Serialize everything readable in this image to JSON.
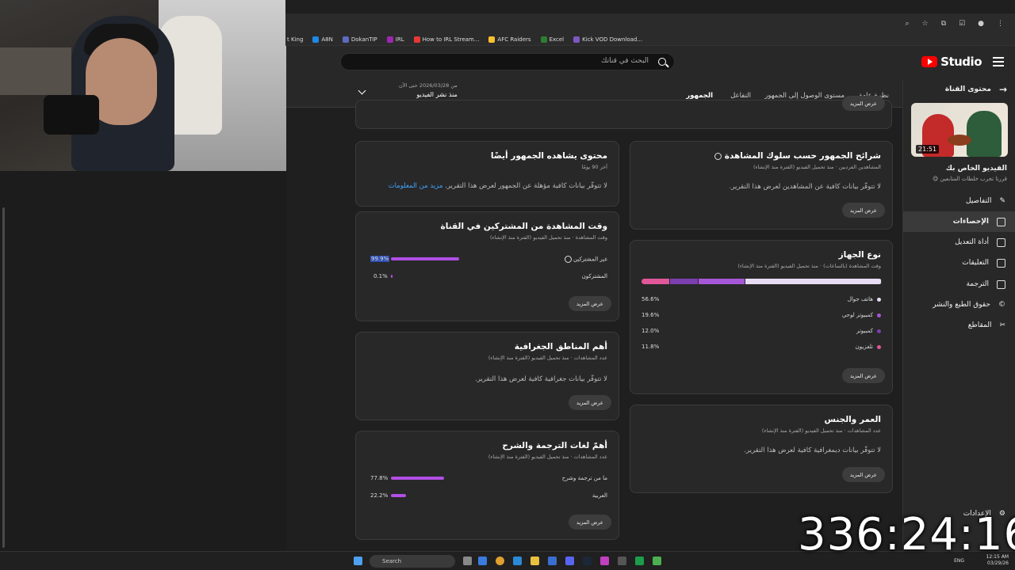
{
  "browser": {
    "bookmarks": [
      "t King",
      "A8N",
      "DokanTIP",
      "IRL",
      "How to IRL Stream...",
      "AFC Raiders",
      "Excel",
      "Kick VOD Download..."
    ]
  },
  "header": {
    "logo_text": "Studio",
    "search_placeholder": "البحث في قناتك"
  },
  "sidebar": {
    "back_label": "محتوى القناة",
    "thumb_duration": "21:51",
    "video_label": "الفيديو الخاص بك",
    "video_title": "قررنا تجرب خلطات المتابعين 😋",
    "items": [
      {
        "label": "التفاصيل",
        "icon": "pencil-icon"
      },
      {
        "label": "الإحصاءات",
        "icon": "analytics-icon"
      },
      {
        "label": "أداة التعديل",
        "icon": "editor-icon"
      },
      {
        "label": "التعليقات",
        "icon": "comments-icon"
      },
      {
        "label": "الترجمة",
        "icon": "subtitles-icon"
      },
      {
        "label": "حقوق الطبع والنشر",
        "icon": "copyright-icon"
      },
      {
        "label": "المقاطع",
        "icon": "scissors-icon"
      }
    ],
    "settings_label": "الإعدادات"
  },
  "tabs": {
    "overview": "نظرة عامة",
    "reach": "مستوى الوصول إلى الجمهور",
    "engagement": "التفاعل",
    "audience": "الجمهور"
  },
  "date_range": {
    "range": "من 2026/03/28 حتى الآن",
    "label": "منذ نشر الفيديو"
  },
  "common": {
    "see_more": "عرض المزيد",
    "no_data": "لا تتوفّر بيانات كافية عن المشاهدين لعرض هذا التقرير."
  },
  "cards": {
    "audience_segments": {
      "title": "شرائح الجمهور حسب سلوك المشاهدة",
      "subtitle": "المشاهدين الفرديين · منذ تحميل الفيديو (الفترة منذ الإنشاء)",
      "message": "لا تتوفّر بيانات كافية عن المشاهدين لعرض هذا التقرير."
    },
    "also_watch": {
      "title": "محتوى يشاهده الجمهور أيضًا",
      "subtitle": "آخر 90 يومًا",
      "message": "لا تتوفّر بيانات كافية مؤهلة عن الجمهور لعرض هذا التقرير.",
      "link": "مزيد من المعلومات"
    },
    "subscribers": {
      "title": "وقت المشاهدة من المشتركين في القناة",
      "subtitle": "وقت المشاهدة · منذ تحميل الفيديو (الفترة منذ الإنشاء)",
      "rows": [
        {
          "label": "غير المشتركين",
          "pct": "99.9%",
          "value": 99.9
        },
        {
          "label": "المشتركون",
          "pct": "0.1%",
          "value": 0.1
        }
      ]
    },
    "device": {
      "title": "نوع الجهاز",
      "subtitle": "وقت المشاهدة (بالساعات) · منذ تحميل الفيديو (الفترة منذ الإنشاء)",
      "rows": [
        {
          "label": "هاتف جوال",
          "pct": "56.6%",
          "value": 56.6,
          "color": "#e8dcf5"
        },
        {
          "label": "كمبيوتر لوحي",
          "pct": "19.6%",
          "value": 19.6,
          "color": "#a657d8"
        },
        {
          "label": "كمبيوتر",
          "pct": "12.0%",
          "value": 12.0,
          "color": "#7b3fb0"
        },
        {
          "label": "تلفزيون",
          "pct": "11.8%",
          "value": 11.8,
          "color": "#e0579a"
        }
      ]
    },
    "geography": {
      "title": "أهم المناطق الجغرافية",
      "subtitle": "عدد المشاهدات · منذ تحميل الفيديو (الفترة منذ الإنشاء)",
      "message": "لا تتوفّر بيانات جغرافية كافية لعرض هذا التقرير."
    },
    "age_gender": {
      "title": "العمر والجنس",
      "subtitle": "عدد المشاهدات · منذ تحميل الفيديو (الفترة منذ الإنشاء)",
      "message": "لا تتوفّر بيانات ديمغرافية كافية لعرض هذا التقرير."
    },
    "languages": {
      "title": "أهمّ لغات الترجمة والشرح",
      "subtitle": "عدد المشاهدات · منذ تحميل الفيديو (الفترة منذ الإنشاء)",
      "rows": [
        {
          "label": "ما من ترجمة وشرح",
          "pct": "77.8%",
          "value": 77.8
        },
        {
          "label": "العربية",
          "pct": "22.2%",
          "value": 22.2
        }
      ]
    }
  },
  "taskbar": {
    "search": "Search",
    "lang": "ENG",
    "time": "12:15 AM",
    "date": "03/29/26"
  },
  "overlay": {
    "timer": "336:24:16"
  }
}
